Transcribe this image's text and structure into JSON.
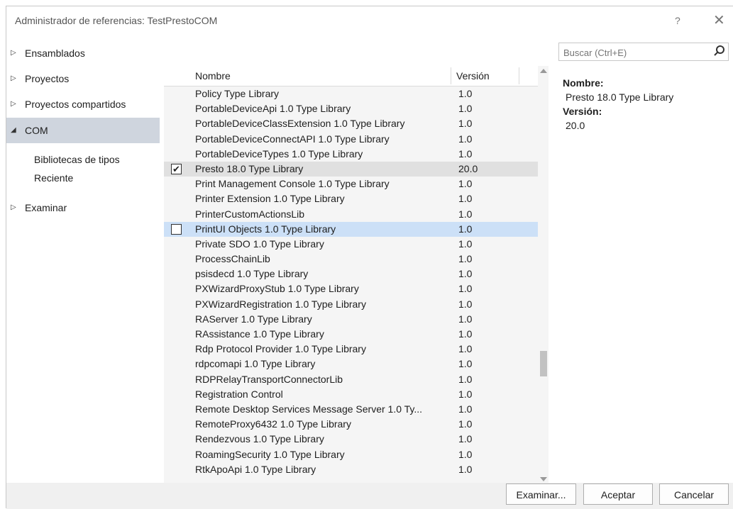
{
  "window": {
    "title": "Administrador de referencias: TestPrestoCOM",
    "help_glyph": "?",
    "close_glyph": "✕"
  },
  "nav": {
    "items": [
      {
        "label": "Ensamblados",
        "arrow": "▷"
      },
      {
        "label": "Proyectos",
        "arrow": "▷"
      },
      {
        "label": "Proyectos compartidos",
        "arrow": "▷"
      },
      {
        "label": "COM",
        "arrow": "◢"
      },
      {
        "label": "Examinar",
        "arrow": "▷"
      }
    ],
    "com_sub": [
      "Bibliotecas de tipos",
      "Reciente"
    ]
  },
  "search": {
    "placeholder": "Buscar (Ctrl+E)",
    "icon": "search-icon"
  },
  "list": {
    "headers": {
      "name": "Nombre",
      "version": "Versión"
    },
    "rows": [
      {
        "name": "Policy Type Library",
        "version": "1.0"
      },
      {
        "name": "PortableDeviceApi 1.0 Type Library",
        "version": "1.0"
      },
      {
        "name": "PortableDeviceClassExtension 1.0 Type Library",
        "version": "1.0"
      },
      {
        "name": "PortableDeviceConnectAPI 1.0 Type Library",
        "version": "1.0"
      },
      {
        "name": "PortableDeviceTypes 1.0 Type Library",
        "version": "1.0"
      },
      {
        "name": "Presto 18.0 Type Library",
        "version": "20.0"
      },
      {
        "name": "Print Management Console 1.0 Type Library",
        "version": "1.0"
      },
      {
        "name": "Printer Extension 1.0 Type Library",
        "version": "1.0"
      },
      {
        "name": "PrinterCustomActionsLib",
        "version": "1.0"
      },
      {
        "name": "PrintUI Objects 1.0 Type Library",
        "version": "1.0"
      },
      {
        "name": "Private SDO 1.0 Type Library",
        "version": "1.0"
      },
      {
        "name": "ProcessChainLib",
        "version": "1.0"
      },
      {
        "name": "psisdecd 1.0 Type Library",
        "version": "1.0"
      },
      {
        "name": "PXWizardProxyStub 1.0 Type Library",
        "version": "1.0"
      },
      {
        "name": "PXWizardRegistration 1.0 Type Library",
        "version": "1.0"
      },
      {
        "name": "RAServer 1.0 Type Library",
        "version": "1.0"
      },
      {
        "name": "RAssistance 1.0 Type Library",
        "version": "1.0"
      },
      {
        "name": "Rdp Protocol Provider 1.0 Type Library",
        "version": "1.0"
      },
      {
        "name": "rdpcomapi 1.0 Type Library",
        "version": "1.0"
      },
      {
        "name": "RDPRelayTransportConnectorLib",
        "version": "1.0"
      },
      {
        "name": "Registration Control",
        "version": "1.0"
      },
      {
        "name": "Remote Desktop Services Message Server 1.0 Ty...",
        "version": "1.0"
      },
      {
        "name": "RemoteProxy6432 1.0 Type Library",
        "version": "1.0"
      },
      {
        "name": "Rendezvous 1.0 Type Library",
        "version": "1.0"
      },
      {
        "name": "RoamingSecurity 1.0 Type Library",
        "version": "1.0"
      },
      {
        "name": "RtkApoApi 1.0 Type Library",
        "version": "1.0"
      }
    ],
    "checked_row": "Presto 18.0 Type Library",
    "check_glyph": "✔"
  },
  "details": {
    "name_label": "Nombre:",
    "name_value": "Presto 18.0 Type Library",
    "version_label": "Versión:",
    "version_value": "20.0"
  },
  "buttons": {
    "browse": "Examinar...",
    "ok": "Aceptar",
    "cancel": "Cancelar"
  }
}
